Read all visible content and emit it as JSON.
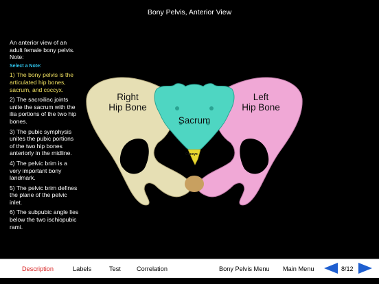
{
  "title": "Bony Pelvis, Anterior View",
  "sidebar": {
    "intro": "An anterior view of an adult female bony pelvis. Note:",
    "select_label": "Select a Note:",
    "notes": [
      "1) The bony pelvis is the articulated hip bones, sacrum, and coccyx.",
      "2) The sacroiliac joints unite the sacrum with the ilia portions of the two hip bones.",
      "3) The pubic symphysis unites the pubic portions of the two hip bones anteriorly in the midline.",
      "4) The pelvic brim is a very important bony landmark.",
      "5) The pelvic brim defines the plane of the pelvic inlet.",
      "6) The subpubic angle lies below the two ischiopubic rami."
    ]
  },
  "figure": {
    "right_hip_line1": "Right",
    "right_hip_line2": "Hip Bone",
    "sacrum": "Sacrum",
    "left_hip_line1": "Left",
    "left_hip_line2": "Hip Bone",
    "coccyx": "Coccyx",
    "colors": {
      "right_hip": "#e6dfb4",
      "left_hip": "#f0a8d6",
      "sacrum": "#4ed6c2",
      "coccyx": "#e8d830"
    }
  },
  "bottom_nav": {
    "description": "Description",
    "labels": "Labels",
    "test": "Test",
    "correlation": "Correlation",
    "bony_pelvis_menu": "Bony Pelvis Menu",
    "main_menu": "Main Menu",
    "page_indicator": "8/12",
    "prev_icon": "left-arrow-icon",
    "next_icon": "right-arrow-icon",
    "active_color": "#d82020",
    "arrow_color": "#1f5fd0"
  }
}
